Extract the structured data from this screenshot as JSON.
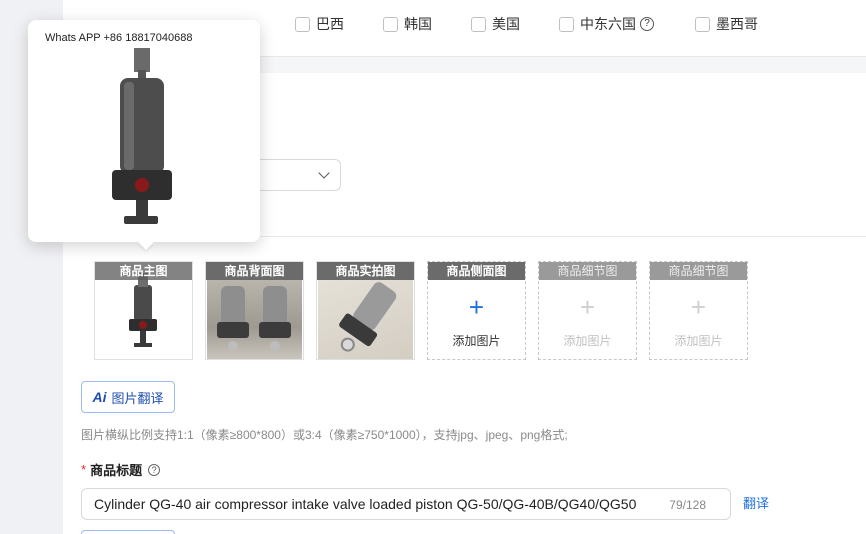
{
  "countries": [
    {
      "label": "巴西"
    },
    {
      "label": "韩国"
    },
    {
      "label": "美国"
    },
    {
      "label": "中东六国"
    },
    {
      "label": "墨西哥"
    }
  ],
  "popover": {
    "watermark": "Whats APP +86 18817040688"
  },
  "image_slots": [
    {
      "title": "商品主图",
      "state": "filled"
    },
    {
      "title": "商品背面图",
      "state": "filled"
    },
    {
      "title": "商品实拍图",
      "state": "filled"
    },
    {
      "title": "商品侧面图",
      "state": "empty-active",
      "add_label": "添加图片"
    },
    {
      "title": "商品细节图",
      "state": "empty-disabled",
      "add_label": "添加图片"
    },
    {
      "title": "商品细节图",
      "state": "empty-disabled",
      "add_label": "添加图片"
    }
  ],
  "image_translate_button": {
    "icon_text": "Ai",
    "label": "图片翻译"
  },
  "image_hint": "图片横纵比例支持1:1（像素≥800*800）或3:4（像素≥750*1000），支持jpg、jpeg、png格式;",
  "product_title": {
    "required_mark": "*",
    "label": "商品标题",
    "value": "Cylinder QG-40 air compressor intake valve loaded piston QG-50/QG-40B/QG40/QG50",
    "count": "79/128",
    "translate_label": "翻译"
  },
  "colors": {
    "accent": "#1f6fe0",
    "required": "#e0301e",
    "slot_header": "#6b6b6b"
  }
}
